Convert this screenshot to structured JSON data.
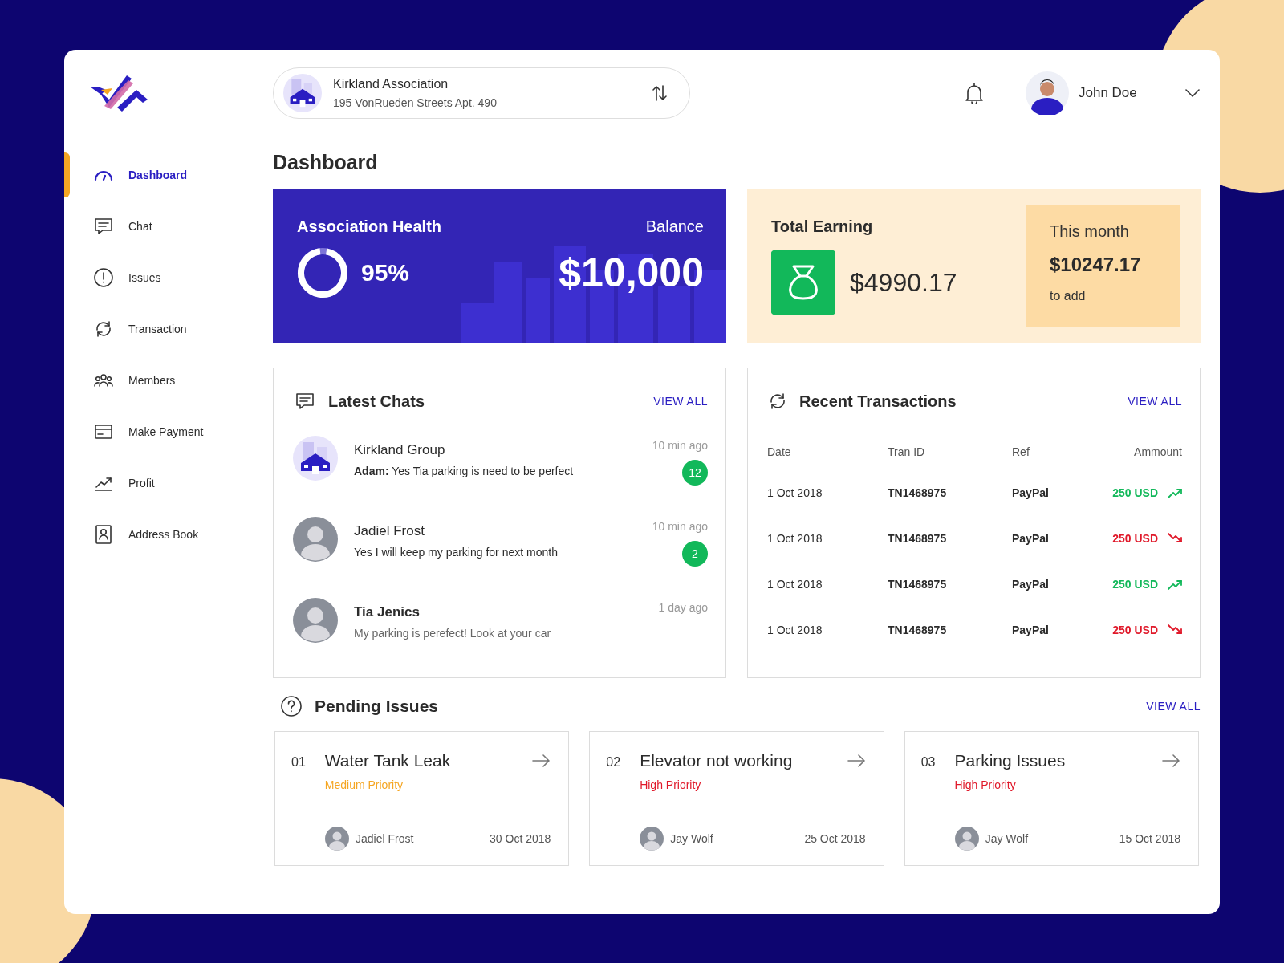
{
  "association": {
    "name": "Kirkland Association",
    "address": "195 VonRueden Streets Apt. 490"
  },
  "user": {
    "name": "John Doe"
  },
  "sidebar": {
    "items": [
      {
        "label": "Dashboard",
        "kind": "gauge",
        "selected": true
      },
      {
        "label": "Chat",
        "kind": "chat",
        "selected": false
      },
      {
        "label": "Issues",
        "kind": "alert",
        "selected": false
      },
      {
        "label": "Transaction",
        "kind": "cycle",
        "selected": false
      },
      {
        "label": "Members",
        "kind": "people",
        "selected": false
      },
      {
        "label": "Make Payment",
        "kind": "card",
        "selected": false
      },
      {
        "label": "Profit",
        "kind": "profit",
        "selected": false
      },
      {
        "label": "Address Book",
        "kind": "contact",
        "selected": false
      }
    ]
  },
  "page_title": "Dashboard",
  "health_card": {
    "title": "Association Health",
    "percent": "95%",
    "level": 0.95,
    "balance_label": "Balance",
    "balance": "$10,000"
  },
  "earning_card": {
    "title": "Total Earning",
    "amount": "$4990.17",
    "month_label": "This month",
    "month_amount": "$10247.17",
    "month_note": "to add"
  },
  "latest_chats": {
    "title": "Latest Chats",
    "view_all": "VIEW ALL",
    "chats": [
      {
        "name": "Kirkland Group",
        "message": "**Adam:** Yes Tia parking is need to be perfect",
        "time": "10 min ago",
        "badge": "12",
        "kind": "group",
        "unread": true
      },
      {
        "name": "Jadiel Frost",
        "message": "Yes I will keep my parking for next month",
        "time": "10 min ago",
        "badge": "2",
        "kind": "person",
        "unread": true
      },
      {
        "name": "Tia Jenics",
        "message": "My parking is perefect! Look at your car",
        "time": "1 day ago",
        "kind": "person",
        "unread": false
      }
    ]
  },
  "recent_transactions": {
    "title": "Recent Transactions",
    "view_all": "VIEW ALL",
    "columns": [
      "Date",
      "Tran ID",
      "Ref",
      "Ammount"
    ],
    "rows": [
      {
        "date": "1 Oct 2018",
        "tran_id": "TN1468975",
        "ref": "PayPal",
        "amount": "250 USD",
        "kind": "up"
      },
      {
        "date": "1 Oct 2018",
        "tran_id": "TN1468975",
        "ref": "PayPal",
        "amount": "250 USD",
        "kind": "down"
      },
      {
        "date": "1 Oct 2018",
        "tran_id": "TN1468975",
        "ref": "PayPal",
        "amount": "250 USD",
        "kind": "up"
      },
      {
        "date": "1 Oct 2018",
        "tran_id": "TN1468975",
        "ref": "PayPal",
        "amount": "250 USD",
        "kind": "down"
      }
    ]
  },
  "pending_issues": {
    "title": "Pending Issues",
    "view_all": "VIEW ALL",
    "issues": [
      {
        "number": "01",
        "title": "Water Tank Leak",
        "priority": "Medium Priority",
        "kind": "medium",
        "assignee": "Jadiel Frost",
        "date": "30 Oct 2018"
      },
      {
        "number": "02",
        "title": "Elevator not working",
        "priority": "High Priority",
        "kind": "high",
        "assignee": "Jay Wolf",
        "date": "25 Oct 2018"
      },
      {
        "number": "03",
        "title": "Parking Issues",
        "priority": "High Priority",
        "kind": "high",
        "assignee": "Jay Wolf",
        "date": "15 Oct 2018"
      }
    ]
  }
}
